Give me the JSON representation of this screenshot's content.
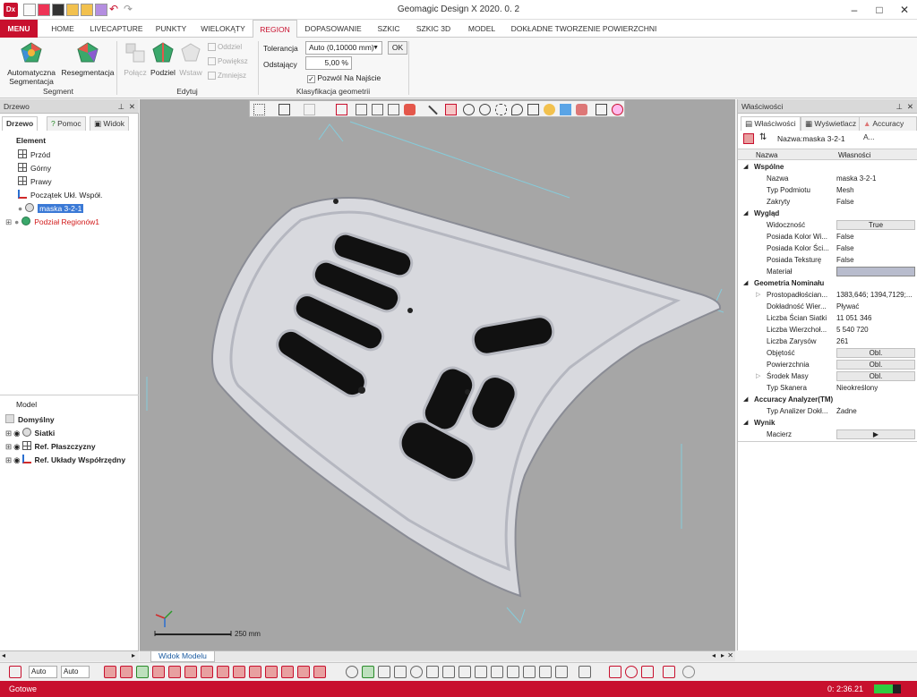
{
  "window": {
    "title": "Geomagic Design X 2020. 0. 2",
    "logo_text": "Dx",
    "controls": [
      "–",
      "□",
      "✕"
    ]
  },
  "ribbon_tabs": [
    "MENU",
    "HOME",
    "LIVECAPTURE",
    "PUNKTY",
    "WIELOKĄTY",
    "REGION",
    "DOPASOWANIE",
    "SZKIC",
    "SZKIC 3D",
    "MODEL",
    "DOKŁADNE TWORZENIE POWIERZCHNI"
  ],
  "ribbon": {
    "segment": {
      "label": "Segment",
      "auto_seg": "Automatyczna Segmentacja",
      "auto_seg_l1": "Automatyczna",
      "auto_seg_l2": "Segmentacja",
      "reseg": "Resegmentacja"
    },
    "edytuj": {
      "label": "Edytuj",
      "polacz": "Połącz",
      "podziel": "Podziel",
      "wstaw": "Wstaw",
      "oddziel": "Oddziel",
      "powieksz": "Powiększ",
      "zmniejsz": "Zmniejsz"
    },
    "klasyfikacja": {
      "label": "Klasyfikacja geometrii",
      "tolerancja_label": "Tolerancja",
      "tolerancja_value": "Auto (0,10000 mm)",
      "odstajacy_label": "Odstający",
      "odstajacy_value": "5,00 %",
      "checkbox_label": "Pozwól Na Najście",
      "ok": "OK"
    }
  },
  "left_panel": {
    "title": "Drzewo",
    "tabs": [
      "Drzewo",
      "Pomoc",
      "Widok"
    ],
    "element_header": "Element",
    "elements": [
      "Przód",
      "Górny",
      "Prawy",
      "Początek Ukł. Współ.",
      "maska 3-2-1",
      "Podział Regionów1"
    ],
    "model_header": "Model",
    "model_items": [
      "Domyślny",
      "Siatki",
      "Ref. Płaszczyzny",
      "Ref. Układy Współrzędny"
    ]
  },
  "viewport": {
    "scale_label": "250 mm",
    "tab_label": "Widok Modelu"
  },
  "right_panel": {
    "title": "Właściwości",
    "tabs": [
      "Właściwości",
      "Wyświetlacz",
      "Accuracy A..."
    ],
    "object_label": "Nazwa:maska 3-2-1",
    "col_name": "Nazwa",
    "col_value": "Własności",
    "wspolne": "Wspólne",
    "nazwa_k": "Nazwa",
    "nazwa_v": "maska 3-2-1",
    "typ_k": "Typ Podmiotu",
    "typ_v": "Mesh",
    "zakryty_k": "Zakryty",
    "zakryty_v": "False",
    "wyglad": "Wygląd",
    "widocznosc_k": "Widoczność",
    "widocznosc_v": "True",
    "posiada1_k": "Posiada Kolor Wi...",
    "posiada1_v": "False",
    "posiada2_k": "Posiada Kolor Ści...",
    "posiada2_v": "False",
    "posiada3_k": "Posiada Teksturę",
    "posiada3_v": "False",
    "material_k": "Materiał",
    "geometria": "Geometria Nominału",
    "prosto_k": "Prostopadłościan...",
    "prosto_v": "1383,646; 1394,7129;...",
    "dokl_k": "Dokładność Wier...",
    "dokl_v": "Pływać",
    "sciany_k": "Liczba Ścian Siatki",
    "sciany_v": "11 051 346",
    "wierz_k": "Liczba Wierzchoł...",
    "wierz_v": "5 540 720",
    "zarys_k": "Liczba Zarysów",
    "zarys_v": "261",
    "objetosc_k": "Objętość",
    "obl": "Obl.",
    "pow_k": "Powierzchnia",
    "srodek_k": "Środek Masy",
    "skaner_k": "Typ Skanera",
    "skaner_v": "Nieokreślony",
    "accuracy": "Accuracy Analyzer(TM)",
    "analizer_k": "Typ Analizer Dokł...",
    "analizer_v": "Żadne",
    "wynik": "Wynik",
    "macierz_k": "Macierz",
    "macierz_v": "▶"
  },
  "bottom_toolbar": {
    "auto1": "Auto",
    "auto2": "Auto"
  },
  "status": {
    "left": "Gotowe",
    "time": "0: 2:36.21"
  },
  "colors": {
    "brand": "#c8102e",
    "viewport_bg": "#a6a6a6",
    "mesh": "#d8d9de"
  }
}
